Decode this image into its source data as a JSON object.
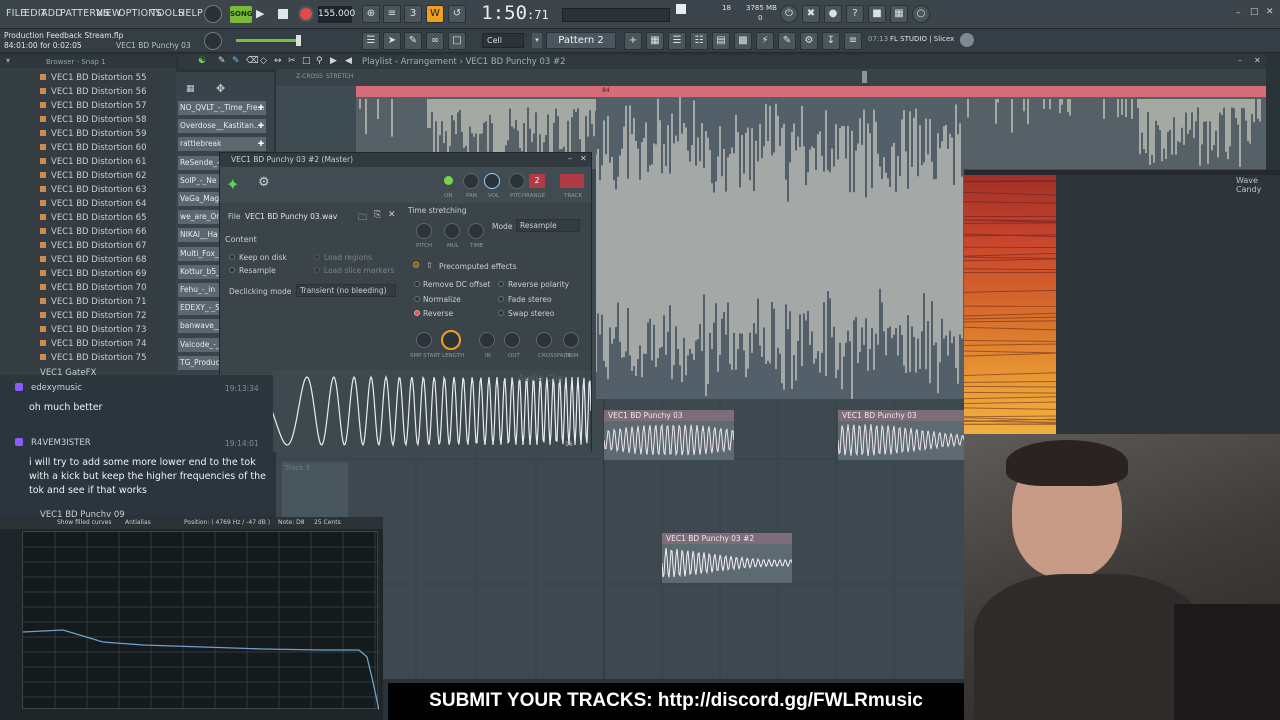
{
  "menu": [
    "FILE",
    "EDIT",
    "ADD",
    "PATTERNS",
    "VIEW",
    "OPTIONS",
    "TOOLS",
    "HELP"
  ],
  "transport": {
    "mode": "SONG",
    "tempo": "155.000",
    "time": "1:50",
    "time_frac": ":71",
    "cpu": "18",
    "mem": "3785 MB",
    "voices": "0"
  },
  "project": {
    "name": "Production Feedback Stream.flp",
    "hint_time": "84:01:00 for 0:02:05",
    "hint_clip": "VEC1 BD Punchy 03"
  },
  "toolbar": {
    "snap": "Cell",
    "pattern": "Pattern 2",
    "version": "07:13",
    "product": "FL STUDIO | Slicex"
  },
  "browser": {
    "title": "Browser - Snap 1",
    "items": [
      "VEC1 BD Distortion 55",
      "VEC1 BD Distortion 56",
      "VEC1 BD Distortion 57",
      "VEC1 BD Distortion 58",
      "VEC1 BD Distortion 59",
      "VEC1 BD Distortion 60",
      "VEC1 BD Distortion 61",
      "VEC1 BD Distortion 62",
      "VEC1 BD Distortion 63",
      "VEC1 BD Distortion 64",
      "VEC1 BD Distortion 65",
      "VEC1 BD Distortion 66",
      "VEC1 BD Distortion 67",
      "VEC1 BD Distortion 68",
      "VEC1 BD Distortion 69",
      "VEC1 BD Distortion 70",
      "VEC1 BD Distortion 71",
      "VEC1 BD Distortion 72",
      "VEC1 BD Distortion 73",
      "VEC1 BD Distortion 74",
      "VEC1 BD Distortion 75"
    ],
    "folder": "VEC1 GateFX",
    "partial": "VEC1 BD Punchy 09"
  },
  "picker": [
    "NO_QVLT_-_Time_Fre...",
    "Overdose__Kastitan..",
    "rattlebreak",
    "ReSende_-_",
    "SoIP_-_Ne",
    "VaGa_Mage",
    "we_are_On",
    "NIKAI__Ha",
    "Multi_Fox_",
    "Kottur_b5_",
    "Fehu_-_in",
    "EDEXY_-_S",
    "banwave__",
    "Valcode_-_",
    "TG_Product"
  ],
  "playlist": {
    "title": "Playlist - Arrangement",
    "sep": "›",
    "clip_name": "VEC1 BD Punchy 03 #2",
    "track3": "Track 3",
    "ruler_marker": "84",
    "zcross": "Z-CROSS",
    "stretch": "STRETCH"
  },
  "clips": [
    {
      "name": "VEC1 BD Punchy 03"
    },
    {
      "name": "VEC1 BD Punchy 03"
    },
    {
      "name": "VEC1 BD Punchy 03 #2"
    }
  ],
  "sampler": {
    "title": "VEC1 BD Punchy 03 #2 (Master)",
    "file_label": "File",
    "file_name": "VEC1 BD Punchy 03.wav",
    "content_label": "Content",
    "keep_on_disk": "Keep on disk",
    "resample": "Resample",
    "load_regions": "Load regions",
    "load_slice_markers": "Load slice markers",
    "declicking_label": "Declicking mode",
    "declicking_value": "Transient (no bleeding)",
    "time_stretching": "Time stretching",
    "mode_label": "Mode",
    "mode_value": "Resample",
    "precomputed": "Precomputed effects",
    "effects": [
      "Remove DC offset",
      "Normalize",
      "Reverse",
      "Reverse polarity",
      "Fade stereo",
      "Swap stereo"
    ],
    "knob_labels": [
      "ON",
      "PAN",
      "VOL",
      "PITCH",
      "RANGE",
      "TRACK"
    ],
    "ts_knobs": [
      "PITCH",
      "MUL",
      "TIME"
    ],
    "fx_knobs": [
      "SMP START",
      "LENGTH",
      "IN",
      "OUT",
      "CROSSFADE",
      "TRIM"
    ],
    "track_num": "2",
    "wave_label": "Audio Clip",
    "wave_num": "16"
  },
  "chat": [
    {
      "user": "edexymusic",
      "time": "19:13:34",
      "text": "oh much better"
    },
    {
      "user": "R4VEM3ISTER",
      "time": "19:14:01",
      "text": "i will try to add some more lower end to the tok with a kick but keep the higher frequencies of the tok and see if that works"
    }
  ],
  "eq": {
    "opt1": "Show filled curves",
    "opt2": "Antialias",
    "position": "Position: ( 4769 Hz / -47 dB )",
    "note": "Note: D8",
    "cents": "25 Cents"
  },
  "wave_candy": "Wave Candy",
  "banner": "SUBMIT YOUR TRACKS: http://discord.gg/FWLRmusic",
  "colors": {
    "ruler": "#d76c79",
    "clip_header": "#7d6d78",
    "waveform": "#f4f1e2",
    "accent_orange": "#f0a020"
  }
}
